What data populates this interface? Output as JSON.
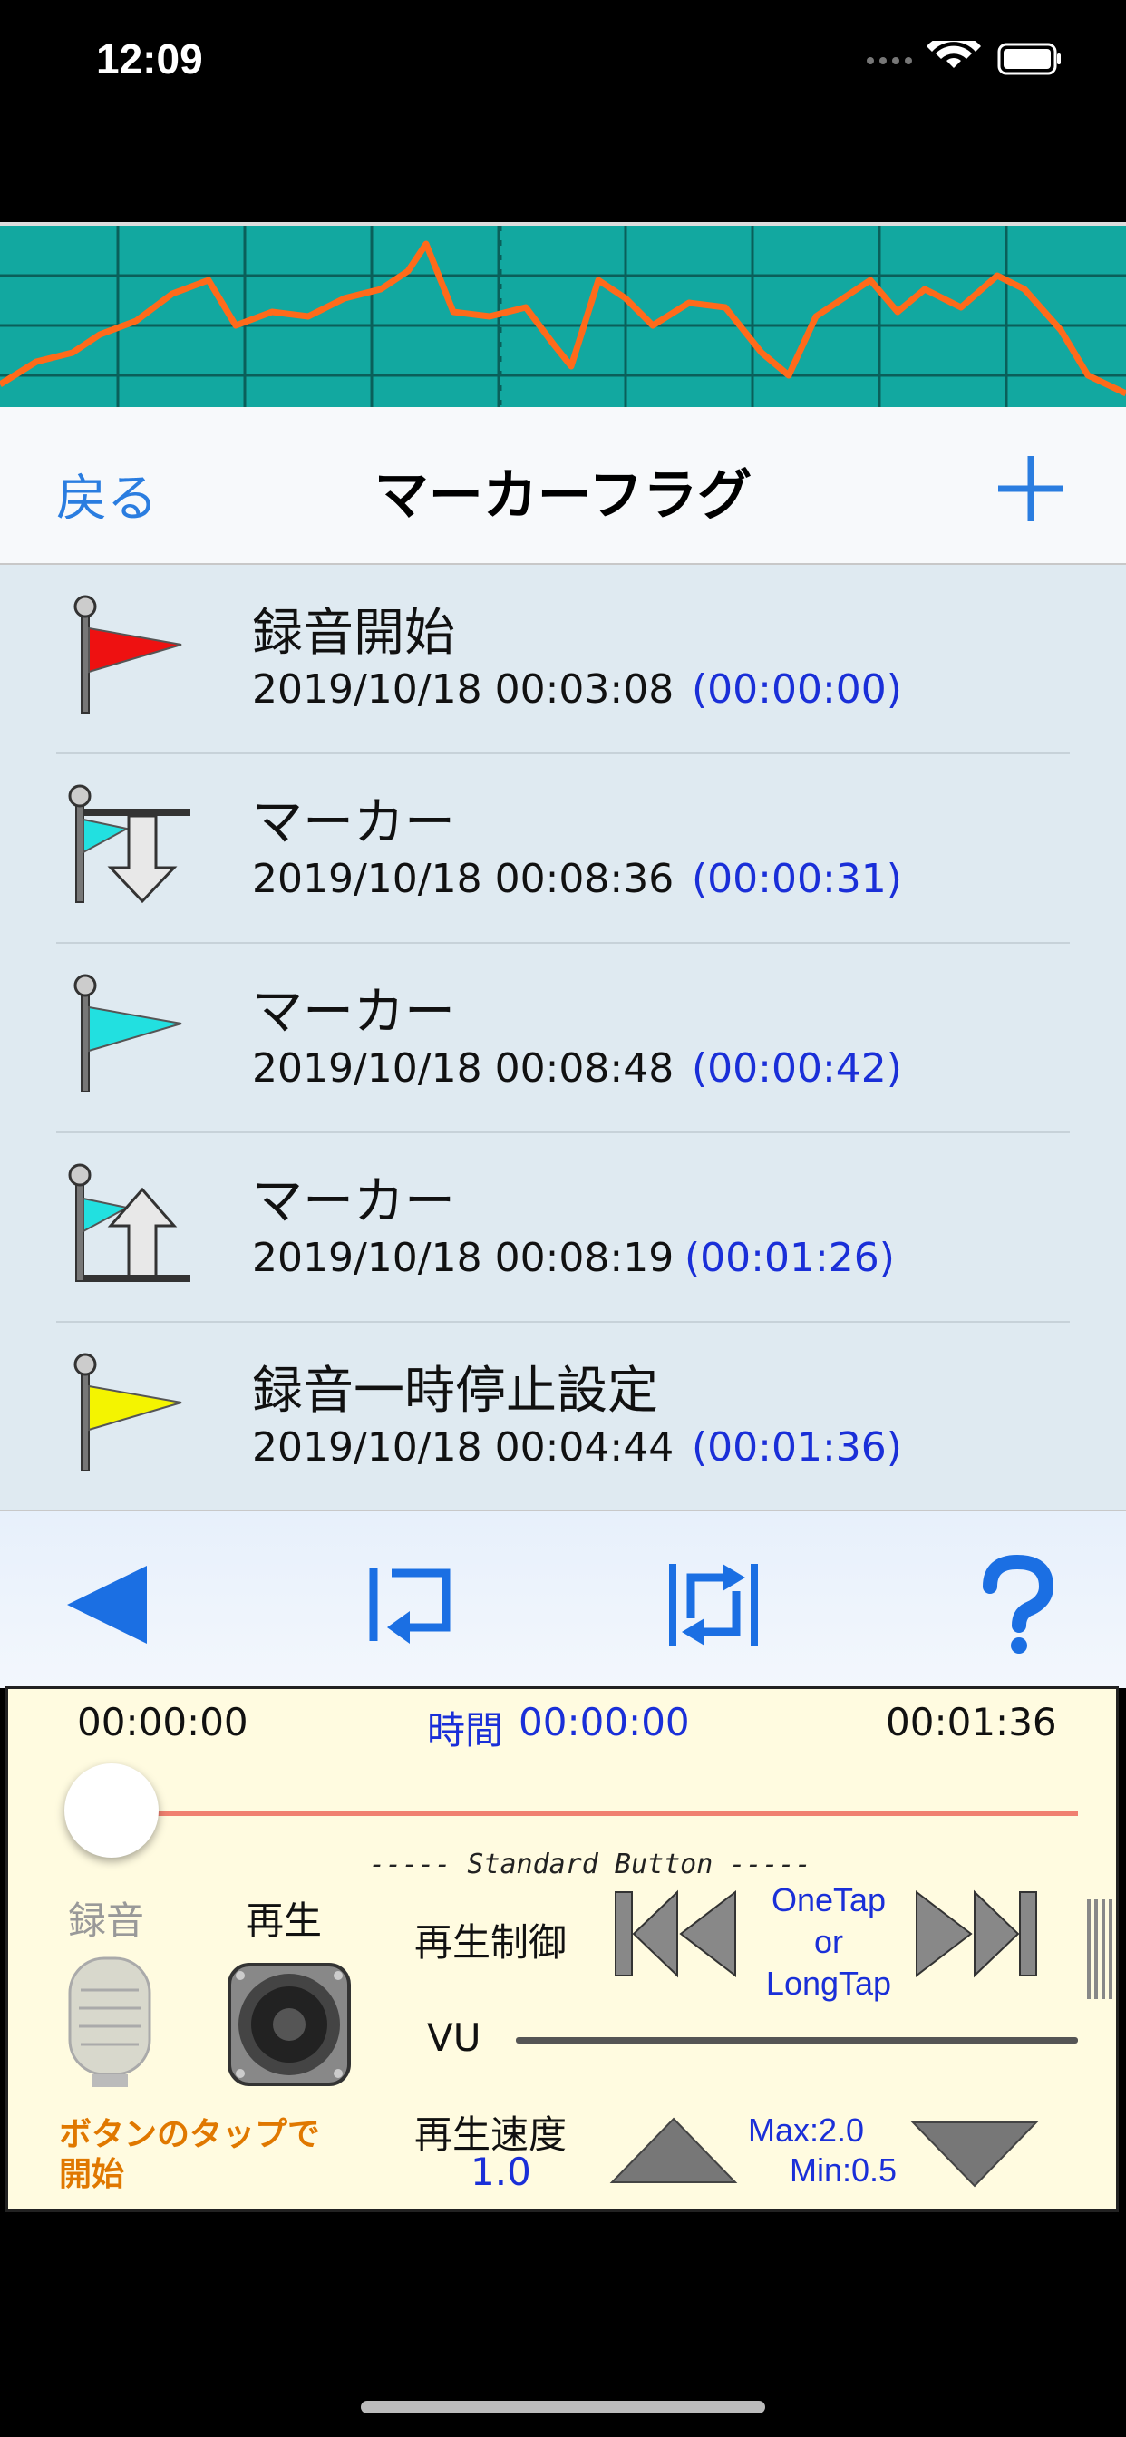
{
  "status_bar": {
    "time": "12:09",
    "icons": [
      "cellular-icon",
      "wifi-icon",
      "battery-icon"
    ]
  },
  "nav": {
    "back_label": "戻る",
    "title": "マーカーフラグ",
    "add_icon": "plus-icon"
  },
  "markers": [
    {
      "icon": "red-flag-icon",
      "title": "録音開始",
      "datetime": "2019/10/18 00:03:08",
      "elapsed": "(00:00:00)"
    },
    {
      "icon": "cyan-flag-down-arrow-icon",
      "title": "マーカー",
      "datetime": "2019/10/18 00:08:36",
      "elapsed": "(00:00:31)"
    },
    {
      "icon": "cyan-flag-icon",
      "title": "マーカー",
      "datetime": "2019/10/18 00:08:48",
      "elapsed": "(00:00:42)"
    },
    {
      "icon": "cyan-flag-up-arrow-icon",
      "title": "マーカー",
      "datetime": "2019/10/18 00:08:19",
      "elapsed": "(00:01:26)"
    },
    {
      "icon": "yellow-flag-icon",
      "title": "録音一時停止設定",
      "datetime": "2019/10/18 00:04:44",
      "elapsed": "(00:01:36)"
    }
  ],
  "toolbar": {
    "buttons": [
      "back-triangle-icon",
      "repeat-one-icon",
      "repeat-all-icon",
      "help-icon"
    ]
  },
  "player": {
    "start_time": "00:00:00",
    "time_label": "時間",
    "current_time": "00:00:00",
    "end_time": "00:01:36",
    "progress": 0.0,
    "standard_button_label": "----- Standard Button -----",
    "record_label": "録音",
    "play_label": "再生",
    "playback_control_label": "再生制御",
    "tap_hint": [
      "OneTap",
      "or",
      "LongTap"
    ],
    "vu_label": "VU",
    "speed_label": "再生速度",
    "speed_value": "1.0",
    "speed_max": "Max:2.0",
    "speed_min": "Min:0.5",
    "start_hint_line1": "ボタンのタップで",
    "start_hint_line2": "開始"
  },
  "colors": {
    "accent": "#2a7de0",
    "elapsed_text": "#1a2fd8",
    "waveform_bg": "#12a8a0",
    "waveform_line": "#ff6a1a",
    "panel_bg": "#fffbe0",
    "progress_track": "#f08070"
  }
}
